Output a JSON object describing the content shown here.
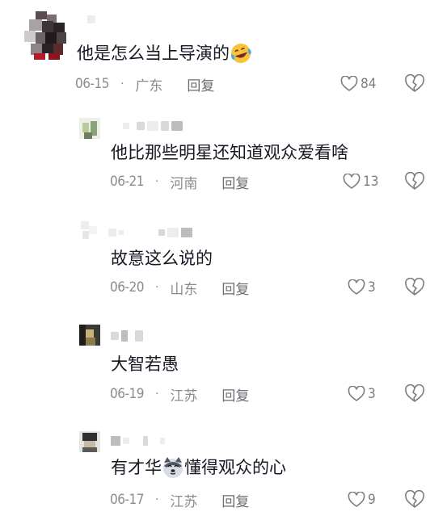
{
  "comments": [
    {
      "text": "他是怎么当上导演的",
      "emoji": "laughing-crying-emoji",
      "date": "06-15",
      "location": "广东",
      "reply_label": "回复",
      "likes": "84"
    },
    {
      "text": "他比那些明星还知道观众爱看啥",
      "date": "06-21",
      "location": "河南",
      "reply_label": "回复",
      "likes": "13"
    },
    {
      "text": "故意这么说的",
      "date": "06-20",
      "location": "山东",
      "reply_label": "回复",
      "likes": "3"
    },
    {
      "text": "大智若愚",
      "date": "06-19",
      "location": "江苏",
      "reply_label": "回复",
      "likes": "3"
    },
    {
      "text_before": "有才华",
      "emoji": "husky-dog-emoji",
      "text_after": "懂得观众的心",
      "date": "06-17",
      "location": "江苏",
      "reply_label": "回复",
      "likes": "9"
    }
  ],
  "separator": "·",
  "icons": {
    "like": "heart-outline-icon",
    "dislike": "broken-heart-icon"
  }
}
